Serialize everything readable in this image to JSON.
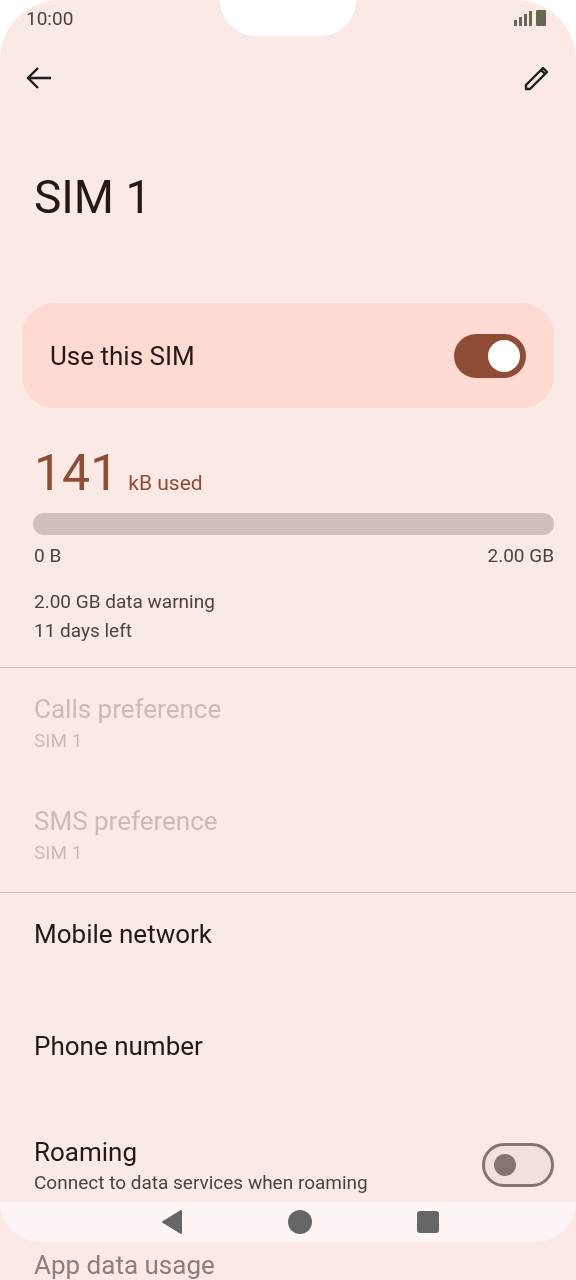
{
  "status_bar": {
    "time": "10:00"
  },
  "title": "SIM 1",
  "use_sim": {
    "label": "Use this SIM",
    "on": true
  },
  "usage": {
    "amount": "141",
    "unit": "kB used",
    "min": "0 B",
    "max": "2.00 GB",
    "warning": "2.00 GB data warning",
    "days_left": "11 days left"
  },
  "preference_items": [
    {
      "title": "Calls preference",
      "summary": "SIM 1",
      "disabled": true
    },
    {
      "title": "SMS preference",
      "summary": "SIM 1",
      "disabled": true
    }
  ],
  "settings_items": [
    {
      "kind": "link",
      "title": "Mobile network"
    },
    {
      "kind": "link",
      "title": "Phone number"
    },
    {
      "kind": "switch",
      "title": "Roaming",
      "summary": "Connect to data services when roaming",
      "on": false
    },
    {
      "kind": "link",
      "title": "App data usage"
    }
  ]
}
